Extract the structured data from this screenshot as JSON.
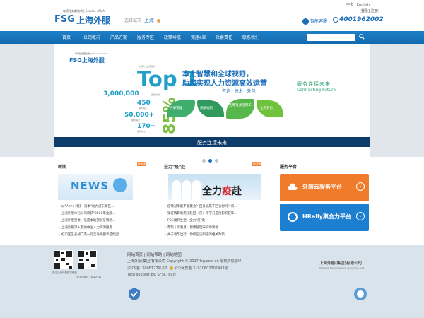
{
  "header": {
    "logo_text_en": "FSG",
    "logo_text_cn": "上海外服",
    "logo_tagline": "每项任务都追求 | Service of Life",
    "city_label": "选择城市",
    "city_value": "上海",
    "lang_cn": "中文",
    "lang_sep": "|",
    "lang_en": "English",
    "login": "[登录]",
    "register": "[注册]",
    "smart_service": "智能客服",
    "hotline": "4001962002"
  },
  "nav": {
    "items": [
      "首页",
      "公司概况",
      "产品方案",
      "服务专区",
      "政策导航",
      "党建e家",
      "社会责任",
      "联系我们"
    ],
    "search_placeholder": ""
  },
  "banner": {
    "logo": "FSG上海外服",
    "logo_small": "每项任务都追求 | Service of Life",
    "top1": "Top 1",
    "top1_sub": "中国人力资源服务",
    "stats": [
      {
        "value": "3,000,000",
        "note": "服务雇员"
      },
      {
        "value": "450",
        "note": "服务网点"
      },
      {
        "value": "50,000+",
        "note": "服务客户"
      },
      {
        "value": "170+",
        "note": "服务城市"
      }
    ],
    "percent": "85%",
    "headline1": "本土智慧和全球视野，",
    "headline2": "助您实现人力资源高效运营",
    "subline": "咨询 · 技术 · 外包",
    "leaves": [
      "人事管理",
      "薪酬福利",
      "招聘及灵活用工",
      "业务外包"
    ],
    "right_cn": "服务连接未来",
    "right_en": "Connecting Future",
    "caption": "服务连接未来",
    "slide_count": 3,
    "active_slide": 2
  },
  "news": {
    "title": "新闻",
    "more": "MORE",
    "image_text": "NEWS",
    "items": [
      "以\"人才+科技+资本\"助力浦东新区...",
      "上海外服众包公司荣获\"2020年金融...",
      "上海外服受委、低成本助部长坚钢桥...",
      "上海外服深入参加中国人力资源服务...",
      "虹口区区长胡广杰一行走访外服示范集团"
    ]
  },
  "quanli": {
    "title": "全力\"疫\"赴",
    "more": "MORE",
    "image_text_1": "全力",
    "image_text_2": "疫",
    "image_text_3": "赴",
    "items": [
      "疫情过年能不能聚会？回县城属于回农村吗？权...",
      "受疫情影响无法赴回（京）外学习是否影响获毕...",
      "FSG福利生活，全力\"疫\"赴",
      "政策丨高利息：健康管理守护你我他",
      "关于春节出行，你所应该知道的相关政策"
    ]
  },
  "service": {
    "title": "服务平台",
    "btn1": "外服云服务平台",
    "btn2": "HRally聚合力平台",
    "btn1_color": "#f07c2b",
    "btn2_color": "#1d7fd0"
  },
  "footer": {
    "qr1_caption": "关注上海外服官方微信",
    "qr2_caption": "关注外服云下载客户端",
    "links": [
      "网站首页",
      "网站帮助",
      "网站地图"
    ],
    "sep": "|",
    "line1": "上海外服(集团)有限公司 Copyright © 2017 fsg.com.cn 版权所有翻印",
    "line2": "沪ICP备13008127号-12",
    "line3": "沪公网安备 31010602002493号",
    "line4": "Tech support by: SFSCTECH",
    "company_cn": "上海外服(集团)有限公司",
    "company_en": "Shanghai Foreign Service (Group) Co., Ltd."
  }
}
